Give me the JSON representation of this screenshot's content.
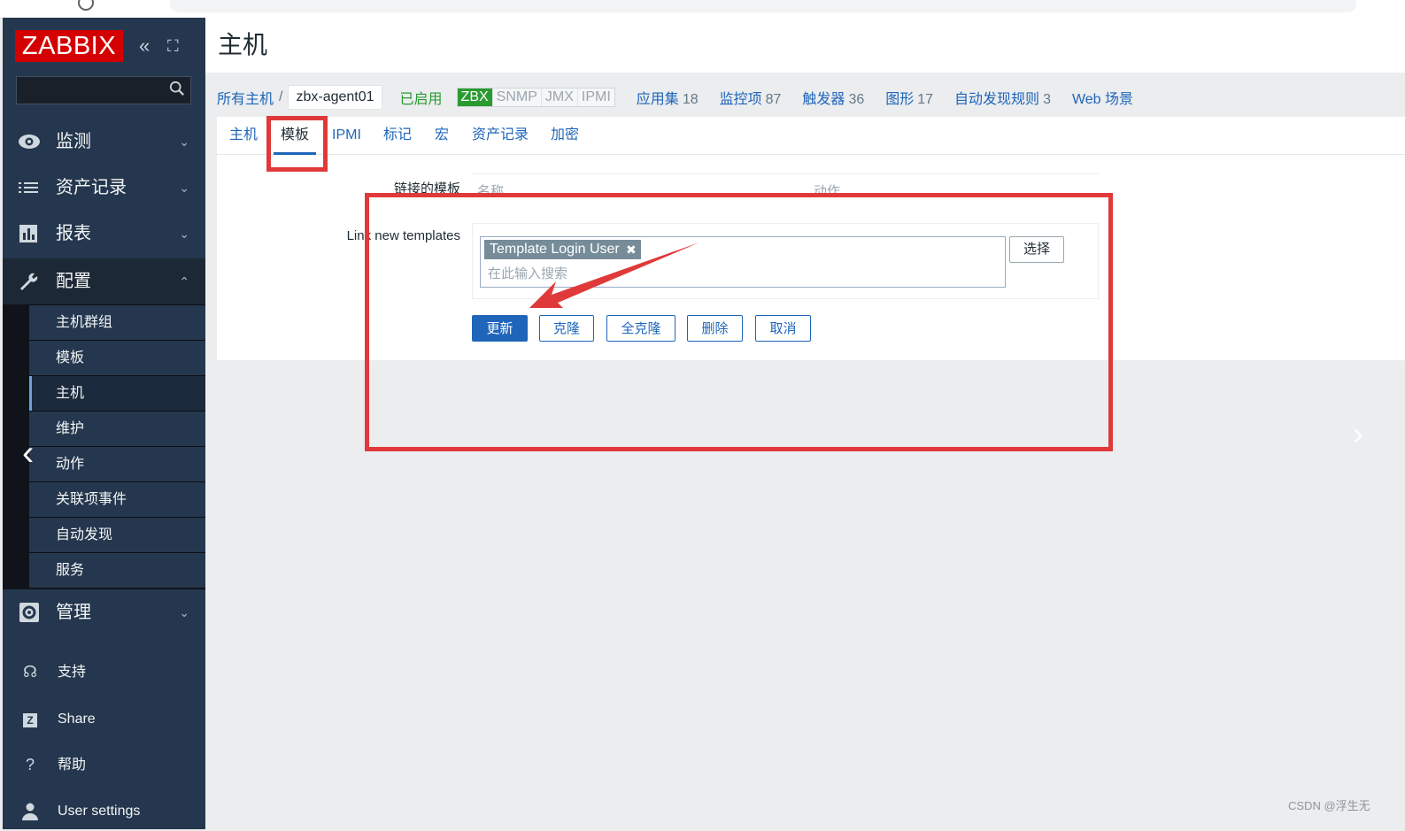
{
  "sidebar": {
    "logo": "ZABBIX",
    "collapse_icon": "«",
    "kiosk_icon": "⛶",
    "menu": [
      {
        "label": "监测",
        "icon": "eye-icon"
      },
      {
        "label": "资产记录",
        "icon": "list-icon"
      },
      {
        "label": "报表",
        "icon": "bar-chart-icon"
      },
      {
        "label": "配置",
        "icon": "wrench-icon"
      }
    ],
    "config_items": [
      "主机群组",
      "模板",
      "主机",
      "维护",
      "动作",
      "关联项事件",
      "自动发现",
      "服务"
    ],
    "active_config_item": "主机",
    "admin_label": "管理",
    "lower": [
      {
        "label": "支持",
        "icon": "headset-icon"
      },
      {
        "label": "Share",
        "icon": "share-icon"
      },
      {
        "label": "帮助",
        "icon": "help-icon"
      },
      {
        "label": "User settings",
        "icon": "user-icon"
      }
    ]
  },
  "header": {
    "title": "主机"
  },
  "breadcrumbs": {
    "all_hosts": "所有主机",
    "separator": "/",
    "host": "zbx-agent01",
    "status": "已启用",
    "availability": [
      "ZBX",
      "SNMP",
      "JMX",
      "IPMI"
    ],
    "links": [
      {
        "label": "应用集",
        "count": "18"
      },
      {
        "label": "监控项",
        "count": "87"
      },
      {
        "label": "触发器",
        "count": "36"
      },
      {
        "label": "图形",
        "count": "17"
      },
      {
        "label": "自动发现规则",
        "count": "3"
      },
      {
        "label": "Web 场景",
        "count": ""
      }
    ]
  },
  "tabs": [
    "主机",
    "模板",
    "IPMI",
    "标记",
    "宏",
    "资产记录",
    "加密"
  ],
  "active_tab": "模板",
  "form": {
    "linked_templates_label": "链接的模板",
    "col_name": "名称",
    "col_action": "动作",
    "link_new_label": "Link new templates",
    "selected_template": "Template Login User",
    "chip_close": "✖",
    "search_placeholder": "在此输入搜索",
    "select_button": "选择"
  },
  "buttons": {
    "update": "更新",
    "clone": "克隆",
    "full_clone": "全克隆",
    "delete": "删除",
    "cancel": "取消"
  },
  "watermark": "CSDN @浮生无",
  "colors": {
    "annotation": "#e0393a",
    "brand_red": "#d40000",
    "link_blue": "#1f65b9",
    "sidebar_bg": "#25374e"
  }
}
